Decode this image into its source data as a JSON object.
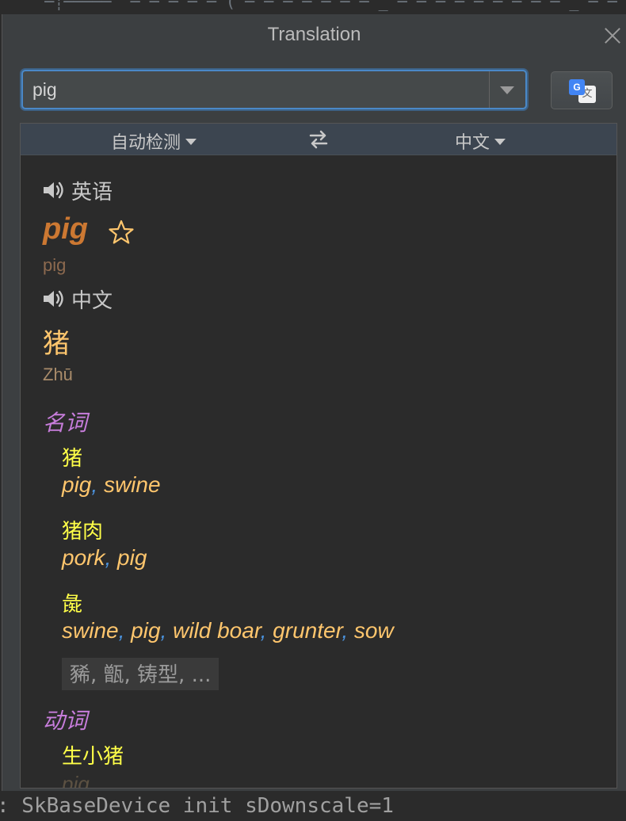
{
  "background_text": {
    "top_fragment": "    ─┊─────  ─ ─ ─ ─ ─ ( ─ ─ ─ ─ ─ ─ ─ _ ─ ─ ─ ─ ─ ─ ─ ─ ─ _ ─ ─",
    "bottom_code": ": SkBaseDevice init sDownscale=1"
  },
  "dialog": {
    "title": "Translation"
  },
  "input": {
    "value": "pig"
  },
  "translate_button": {
    "icon": "google-translate-icon"
  },
  "languages": {
    "source": "自动检测",
    "target": "中文",
    "swap_icon": "swap-arrows-icon"
  },
  "source": {
    "language": "英语",
    "word": "pig",
    "phonetic": "pig"
  },
  "target": {
    "language": "中文",
    "word": "猪",
    "phonetic": "Zhū"
  },
  "dictionary": {
    "noun": {
      "pos": "名词",
      "entries": [
        {
          "zh": "猪",
          "en": [
            "pig",
            "swine"
          ]
        },
        {
          "zh": "猪肉",
          "en": [
            "pork",
            "pig"
          ]
        },
        {
          "zh": "彘",
          "en": [
            "swine",
            "pig",
            "wild boar",
            "grunter",
            "sow"
          ]
        }
      ],
      "more": "豨, 甑, 铸型, ..."
    },
    "verb": {
      "pos": "动词",
      "entries": [
        {
          "zh": "生小猪",
          "en": [
            "pig"
          ]
        }
      ]
    }
  },
  "colors": {
    "accent": "#4a88c7",
    "word_en": "#cc7832",
    "pos": "#c77ddb",
    "entry_zh": "#ffff48",
    "entry_en": "#ffc66d",
    "comma": "#4a90d9"
  }
}
